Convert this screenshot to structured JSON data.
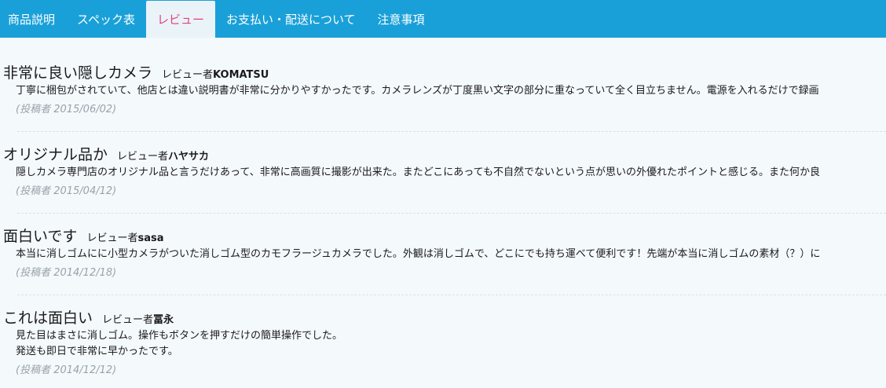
{
  "tabs": [
    {
      "label": "商品説明"
    },
    {
      "label": "スペック表"
    },
    {
      "label": "レビュー"
    },
    {
      "label": "お支払い・配送について"
    },
    {
      "label": "注意事項"
    }
  ],
  "reviewer_prefix": "レビュー者",
  "reviews": [
    {
      "title": "非常に良い隠しカメラ",
      "reviewer": "KOMATSU",
      "lines": [
        "丁寧に梱包がされていて、他店とは違い説明書が非常に分かりやすかったです。カメラレンズが丁度黒い文字の部分に重なっていて全く目立ちません。電源を入れるだけで録画"
      ],
      "date": "(投稿者 2015/06/02)"
    },
    {
      "title": "オリジナル品か",
      "reviewer": "ハヤサカ",
      "lines": [
        "隠しカメラ専門店のオリジナル品と言うだけあって、非常に高画質に撮影が出来た。またどこにあっても不自然でないという点が思いの外優れたポイントと感じる。また何か良"
      ],
      "date": "(投稿者 2015/04/12)"
    },
    {
      "title": "面白いです",
      "reviewer": "sasa",
      "lines": [
        "本当に消しゴムにに小型カメラがついた消しゴム型のカモフラージュカメラでした。外観は消しゴムで、どこにでも持ち運べて便利です！先端が本当に消しゴムの素材（？）に"
      ],
      "date": "(投稿者 2014/12/18)"
    },
    {
      "title": "これは面白い",
      "reviewer": "冨永",
      "lines": [
        "見た目はまさに消しゴム。操作もボタンを押すだけの簡単操作でした。",
        "発送も即日で非常に早かったです。"
      ],
      "date": "(投稿者 2014/12/12)"
    }
  ]
}
